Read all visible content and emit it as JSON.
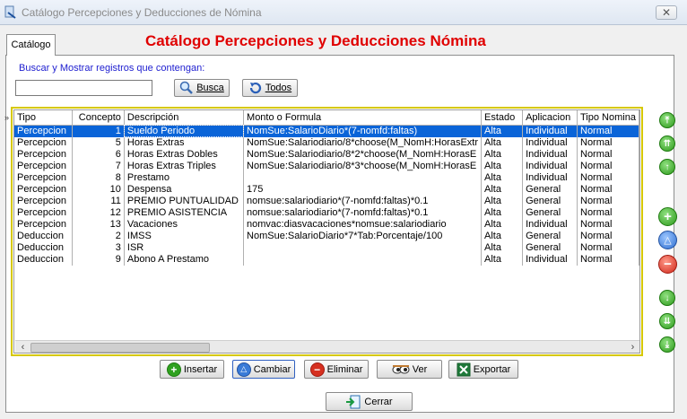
{
  "window": {
    "title": "Catálogo Percepciones y Deducciones de Nómina",
    "close_symbol": "✕"
  },
  "tab": {
    "label": "Catálogo"
  },
  "heading": "Catálogo Percepciones y Deducciones Nómina",
  "search": {
    "label": "Buscar y Mostrar registros que contengan:",
    "value": "",
    "search_button": "Busca",
    "all_button": "Todos"
  },
  "grid": {
    "indicator": "»",
    "columns": [
      "Tipo",
      "Concepto",
      "Descripción",
      "Monto  o Formula",
      "Estado",
      "Aplicacion",
      "Tipo Nomina"
    ],
    "rows": [
      [
        "Percepcion",
        "1",
        "Sueldo Periodo",
        "NomSue:SalarioDiario*(7-nomfd:faltas)",
        "Alta",
        "Individual",
        "Normal"
      ],
      [
        "Percepcion",
        "5",
        "Horas Extras",
        "NomSue:Salariodiario/8*choose(M_NomH:HorasExtr",
        "Alta",
        "Individual",
        "Normal"
      ],
      [
        "Percepcion",
        "6",
        "Horas Extras Dobles",
        "NomSue:Salariodiario/8*2*choose(M_NomH:HorasE",
        "Alta",
        "Individual",
        "Normal"
      ],
      [
        "Percepcion",
        "7",
        "Horas Extras Triples",
        "NomSue:Salariodiario/8*3*choose(M_NomH:HorasE",
        "Alta",
        "Individual",
        "Normal"
      ],
      [
        "Percepcion",
        "8",
        "Prestamo",
        "",
        "Alta",
        "Individual",
        "Normal"
      ],
      [
        "Percepcion",
        "10",
        "Despensa",
        "175",
        "Alta",
        "General",
        "Normal"
      ],
      [
        "Percepcion",
        "11",
        "PREMIO PUNTUALIDAD",
        "nomsue:salariodiario*(7-nomfd:faltas)*0.1",
        "Alta",
        "General",
        "Normal"
      ],
      [
        "Percepcion",
        "12",
        "PREMIO ASISTENCIA",
        "nomsue:salariodiario*(7-nomfd:faltas)*0.1",
        "Alta",
        "General",
        "Normal"
      ],
      [
        "Percepcion",
        "13",
        "Vacaciones",
        "nomvac:diasvacaciones*nomsue:salariodiario",
        "Alta",
        "Individual",
        "Normal"
      ],
      [
        "Deduccion",
        "2",
        "IMSS",
        "NomSue:SalarioDiario*7*Tab:Porcentaje/100",
        "Alta",
        "General",
        "Normal"
      ],
      [
        "Deduccion",
        "3",
        "ISR",
        "",
        "Alta",
        "General",
        "Normal"
      ],
      [
        "Deduccion",
        "9",
        "Abono A Prestamo",
        "",
        "Alta",
        "Individual",
        "Normal"
      ]
    ],
    "selected_row": 0
  },
  "actions": {
    "insert": "Insertar",
    "change": "Cambiar",
    "delete": "Eliminar",
    "view": "Ver",
    "export": "Exportar",
    "close": "Cerrar"
  }
}
